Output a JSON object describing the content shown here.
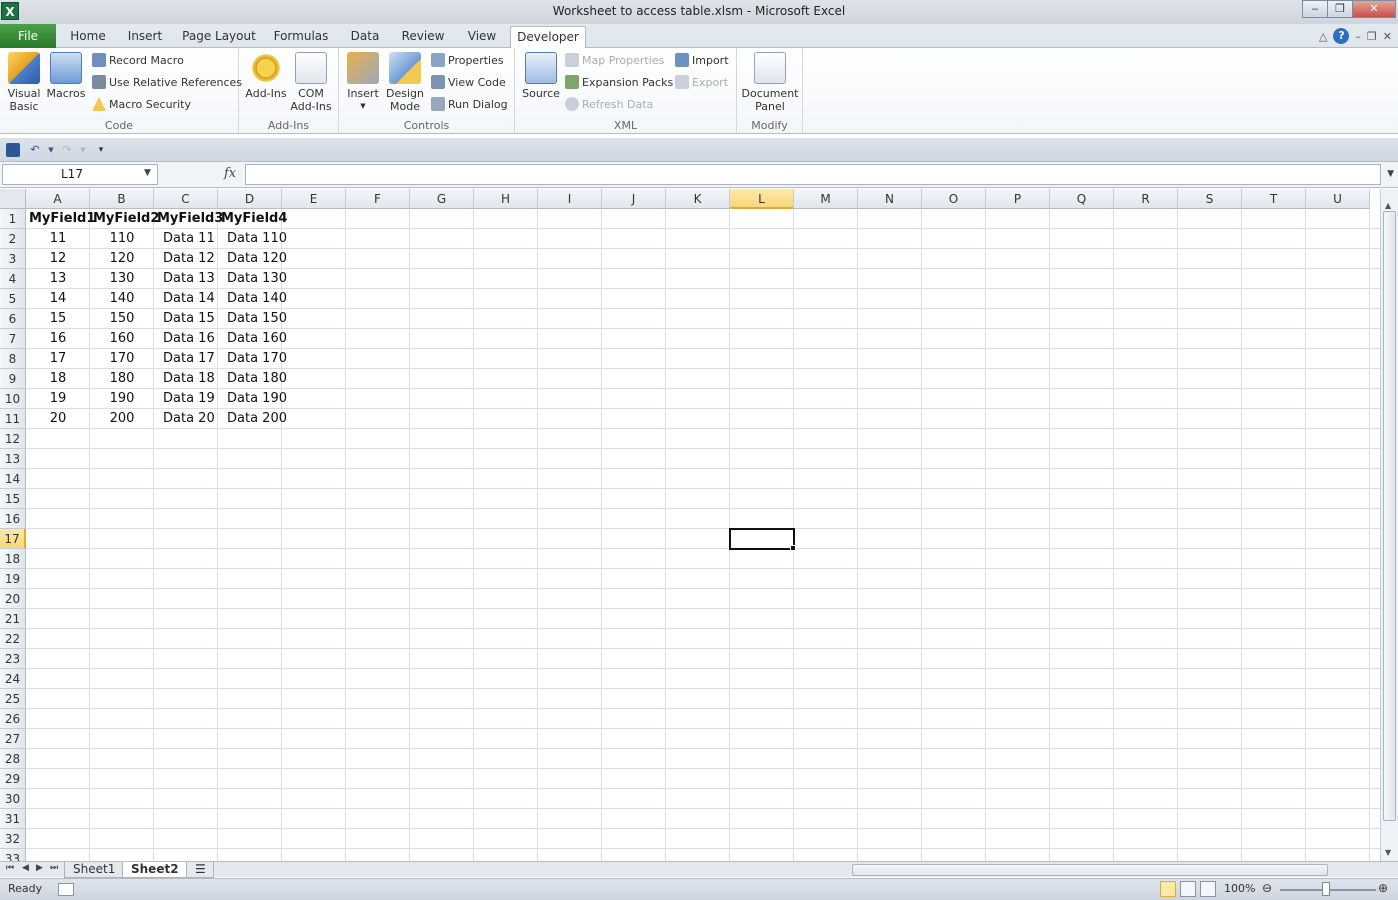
{
  "window": {
    "title": "Worksheet to access table.xlsm  -  Microsoft Excel",
    "app_icon": "X"
  },
  "tabs": [
    "File",
    "Home",
    "Insert",
    "Page Layout",
    "Formulas",
    "Data",
    "Review",
    "View",
    "Developer"
  ],
  "active_tab": "Developer",
  "ribbon": {
    "code": {
      "label": "Code",
      "visual_basic": "Visual\nBasic",
      "macros": "Macros",
      "record_macro": "Record Macro",
      "use_relative": "Use Relative References",
      "macro_security": "Macro Security"
    },
    "addins": {
      "label": "Add-Ins",
      "addins": "Add-Ins",
      "com_addins": "COM\nAdd-Ins"
    },
    "controls": {
      "label": "Controls",
      "insert": "Insert",
      "design_mode": "Design\nMode",
      "properties": "Properties",
      "view_code": "View Code",
      "run_dialog": "Run Dialog"
    },
    "xml": {
      "label": "XML",
      "source": "Source",
      "map_properties": "Map Properties",
      "expansion_packs": "Expansion Packs",
      "refresh_data": "Refresh Data",
      "import": "Import",
      "export": "Export"
    },
    "modify": {
      "label": "Modify",
      "document_panel": "Document\nPanel"
    }
  },
  "formula_bar": {
    "name_box": "L17",
    "fx": "fx",
    "formula": ""
  },
  "columns": [
    "A",
    "B",
    "C",
    "D",
    "E",
    "F",
    "G",
    "H",
    "I",
    "J",
    "K",
    "L",
    "M",
    "N",
    "O",
    "P",
    "Q",
    "R",
    "S",
    "T",
    "U"
  ],
  "selected_column": "L",
  "selected_row": 17,
  "row_count": 33,
  "table": {
    "headers": [
      "MyField1",
      "MyField2",
      "MyField3",
      "MyField4"
    ],
    "rows": [
      [
        "11",
        "110",
        "Data 11",
        "Data 110"
      ],
      [
        "12",
        "120",
        "Data 12",
        "Data 120"
      ],
      [
        "13",
        "130",
        "Data 13",
        "Data 130"
      ],
      [
        "14",
        "140",
        "Data 14",
        "Data 140"
      ],
      [
        "15",
        "150",
        "Data 15",
        "Data 150"
      ],
      [
        "16",
        "160",
        "Data 16",
        "Data 160"
      ],
      [
        "17",
        "170",
        "Data 17",
        "Data 170"
      ],
      [
        "18",
        "180",
        "Data 18",
        "Data 180"
      ],
      [
        "19",
        "190",
        "Data 19",
        "Data 190"
      ],
      [
        "20",
        "200",
        "Data 20",
        "Data 200"
      ]
    ]
  },
  "sheets": [
    "Sheet1",
    "Sheet2"
  ],
  "active_sheet": "Sheet2",
  "status": {
    "mode": "Ready",
    "zoom": "100%"
  },
  "colors": {
    "file_tab": "#2a7a2a",
    "selection_header": "#f8d77a",
    "gridline": "#dadfe6"
  }
}
